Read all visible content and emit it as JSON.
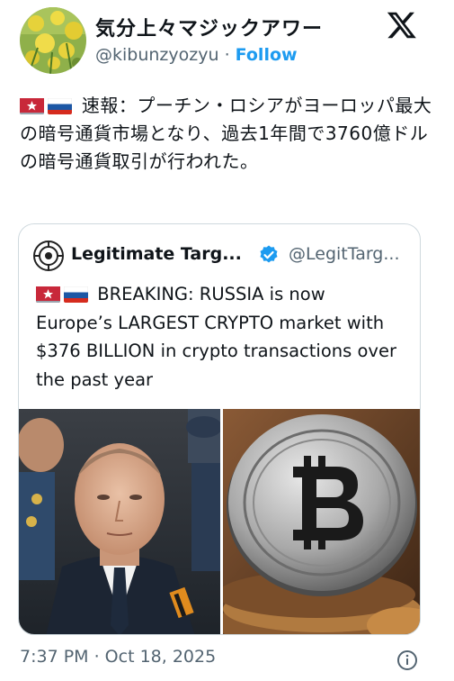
{
  "author": {
    "display_name": "気分上々マジックアワー",
    "handle": "@kibunzyozyu",
    "separator": "·",
    "follow_label": "Follow"
  },
  "tweet": {
    "text": "速報：プーチン・ロシアがヨーロッパ最大の暗号通貨市場となり、過去1年間で3760億ドルの暗号通貨取引が行われた。",
    "flags": [
      "alert-siren-icon",
      "russia-flag-icon"
    ]
  },
  "quote": {
    "name": "Legitimate Targ...",
    "handle": "@LegitTarg...",
    "text": "BREAKING: RUSSIA is now Europe’s LARGEST CRYPTO market with $376 BILLION in crypto transactions over the past year",
    "verified": true
  },
  "footer": {
    "timestamp": "7:37 PM · Oct 18, 2025"
  },
  "colors": {
    "link_blue": "#1d9bf0",
    "muted_gray": "#536471",
    "border": "#cfd9de"
  }
}
